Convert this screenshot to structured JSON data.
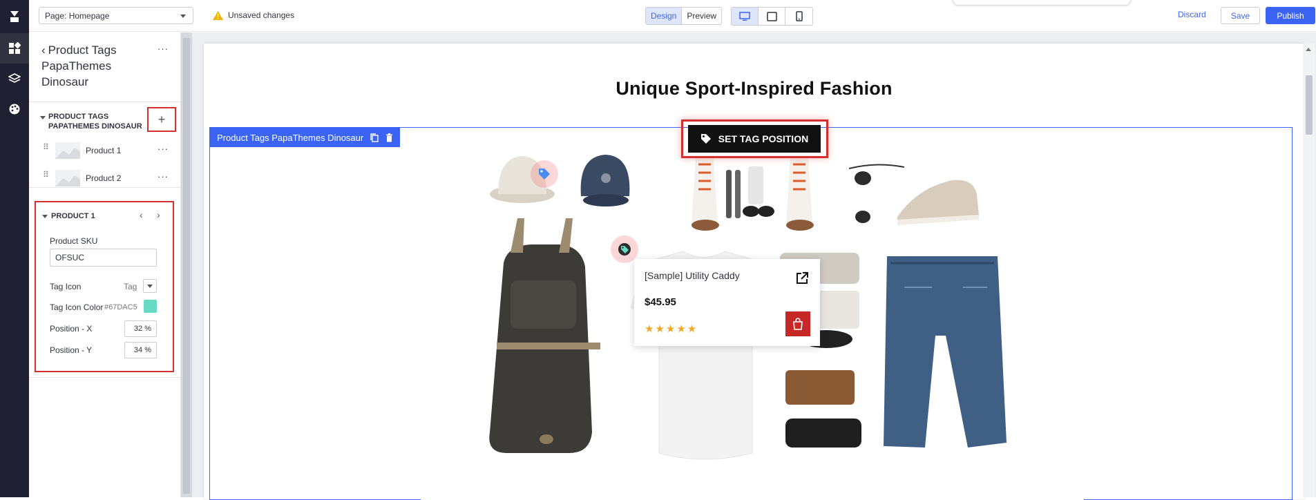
{
  "topbar": {
    "page_select": "Page: Homepage",
    "unsaved": "Unsaved changes",
    "mode_design": "Design",
    "mode_preview": "Preview",
    "discard": "Discard",
    "save": "Save",
    "publish": "Publish"
  },
  "sidebar": {
    "header": "Product Tags PapaThemes Dinosaur",
    "section_title": "PRODUCT TAGS PAPATHEMES DINOSAUR",
    "products": [
      {
        "label": "Product 1"
      },
      {
        "label": "Product 2"
      }
    ],
    "product1": {
      "title": "PRODUCT 1",
      "sku_label": "Product SKU",
      "sku_value": "OFSUC",
      "tag_icon_label": "Tag Icon",
      "tag_icon_value": "Tag",
      "tag_color_label": "Tag Icon Color",
      "tag_color_value": "#67DAC5",
      "pos_x_label": "Position - X",
      "pos_x_value": "32 %",
      "pos_y_label": "Position - Y",
      "pos_y_value": "34 %"
    }
  },
  "canvas": {
    "headline": "Unique Sport-Inspired Fashion",
    "block_label": "Product Tags PapaThemes Dinosaur",
    "set_tag_position": "SET TAG POSITION",
    "popup": {
      "name": "[Sample] Utility Caddy",
      "price": "$45.95",
      "stars": "★★★★★"
    }
  },
  "colors": {
    "accent": "#3c64f4",
    "highlight": "#d32f2f",
    "tag_teal": "#67DAC5",
    "cart_red": "#c62828"
  }
}
